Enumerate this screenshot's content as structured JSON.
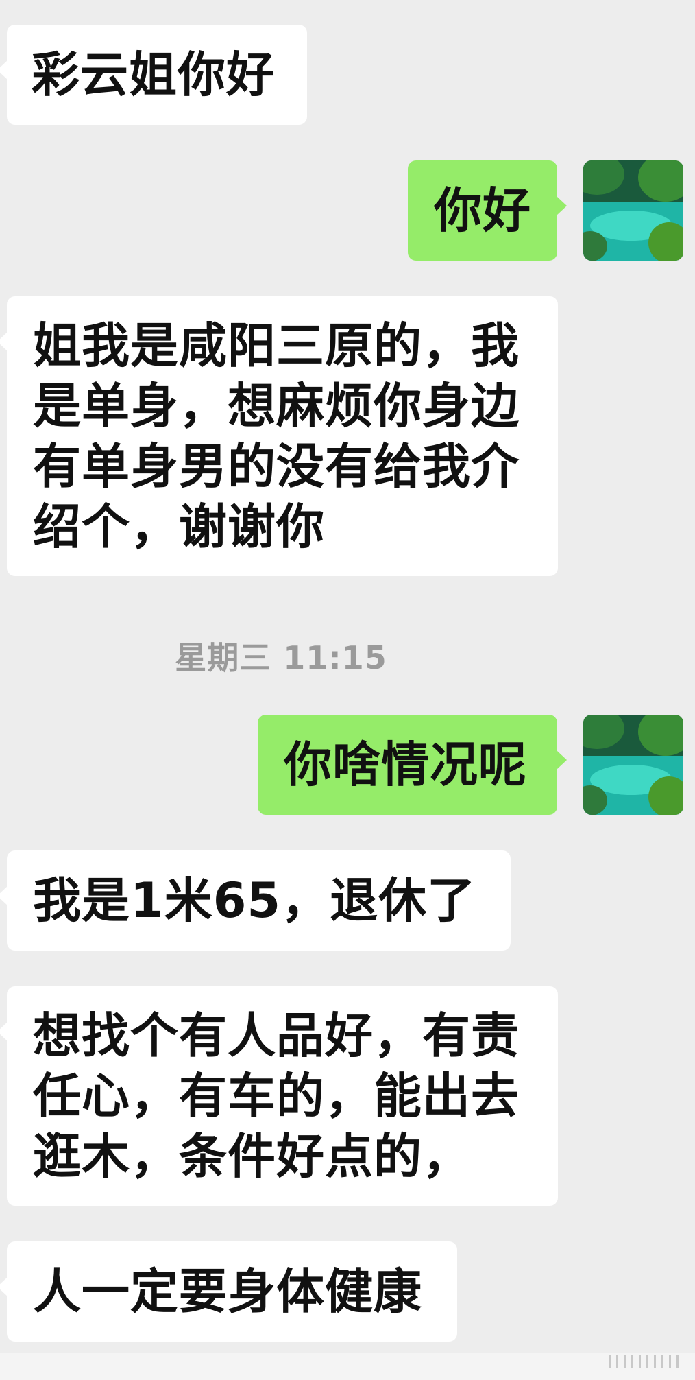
{
  "messages": [
    {
      "side": "in",
      "text": "彩云姐你好"
    },
    {
      "side": "out",
      "text": "你好"
    },
    {
      "side": "in",
      "lines": [
        "姐我是咸阳三原的，我",
        "是单身，想麻烦你身边",
        "有单身男的没有给我介",
        "绍个，谢谢你"
      ]
    },
    {
      "side": "out",
      "text": "你啥情况呢"
    },
    {
      "side": "in",
      "text": "我是1米65，退休了"
    },
    {
      "side": "in",
      "lines": [
        "想找个有人品好，有责",
        "任心，有车的，能出去",
        "逛木，条件好点的，"
      ]
    },
    {
      "side": "in",
      "text": "人一定要身体健康"
    }
  ],
  "timestamp": "星期三 11:15",
  "colors": {
    "background": "#ededed",
    "incoming_bubble": "#ffffff",
    "outgoing_bubble": "#95ec69",
    "timestamp_text": "#9a9a9a"
  },
  "avatar_icon": "landscape-lake-avatar"
}
